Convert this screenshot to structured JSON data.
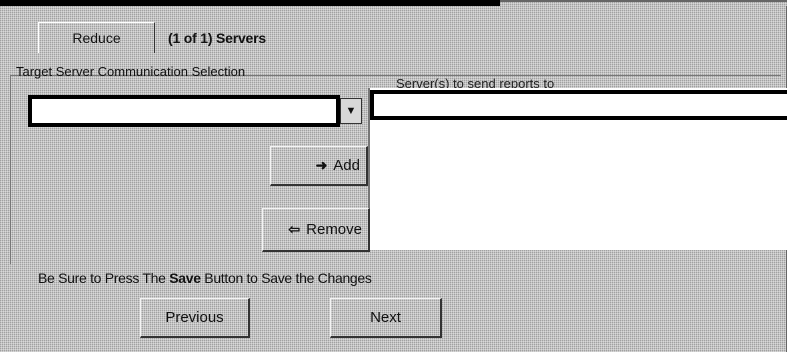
{
  "tab": {
    "label": "Reduce",
    "caption": "(1 of 1) Servers"
  },
  "group": {
    "title": "Target Server Communication Selection"
  },
  "combo": {
    "value": "",
    "dropdown_icon": "chevron-down-icon"
  },
  "list": {
    "label": "Server(s) to send reports to",
    "items": []
  },
  "buttons": {
    "add": "Add",
    "add_icon": "arrow-right-icon",
    "remove": "Remove",
    "remove_icon": "arrow-left-icon",
    "previous": "Previous",
    "next": "Next"
  },
  "notice": {
    "prefix": "Be Sure to Press The ",
    "bold": "Save",
    "suffix": " Button to Save the Changes"
  }
}
